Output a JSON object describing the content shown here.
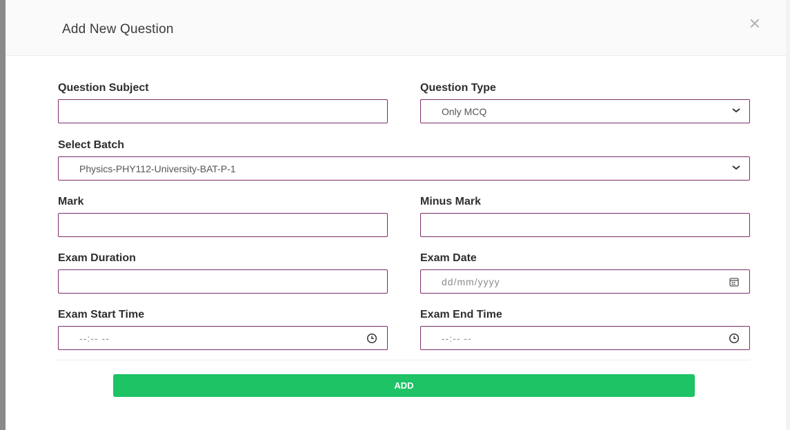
{
  "modal": {
    "title": "Add New Question",
    "close_icon": "close-icon"
  },
  "form": {
    "question_subject": {
      "label": "Question Subject",
      "value": "",
      "placeholder": ""
    },
    "question_type": {
      "label": "Question Type",
      "selected": "Only MCQ"
    },
    "select_batch": {
      "label": "Select Batch",
      "selected": "Physics-PHY112-University-BAT-P-1"
    },
    "mark": {
      "label": "Mark",
      "value": ""
    },
    "minus_mark": {
      "label": "Minus Mark",
      "value": ""
    },
    "exam_duration": {
      "label": "Exam Duration",
      "value": ""
    },
    "exam_date": {
      "label": "Exam Date",
      "placeholder": "dd/mm/yyyy",
      "icon": "calendar-icon"
    },
    "exam_start_time": {
      "label": "Exam Start Time",
      "placeholder": "--:-- --",
      "icon": "clock-icon"
    },
    "exam_end_time": {
      "label": "Exam End Time",
      "placeholder": "--:-- --",
      "icon": "clock-icon"
    }
  },
  "actions": {
    "add_label": "ADD"
  },
  "colors": {
    "field_border": "#7a2b6b",
    "add_button": "#1ec366"
  }
}
